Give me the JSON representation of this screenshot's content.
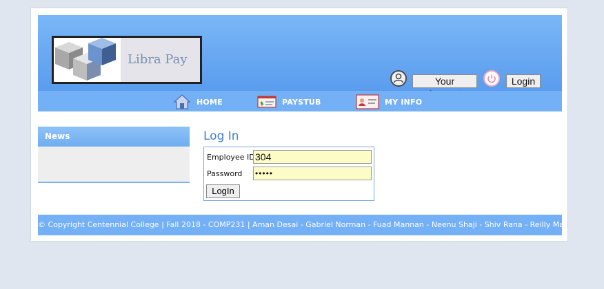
{
  "header": {
    "logo_text": "Libra Pay",
    "account_button": "Your Account",
    "login_button": "Login"
  },
  "nav": {
    "items": [
      {
        "label": "HOME",
        "icon": "home-icon"
      },
      {
        "label": "PAYSTUB",
        "icon": "paystub-icon"
      },
      {
        "label": "MY INFO",
        "icon": "id-card-icon"
      }
    ]
  },
  "news": {
    "title": "News"
  },
  "login": {
    "title": "Log In",
    "employee_id_label": "Employee ID",
    "employee_id_value": "304",
    "password_label": "Password",
    "password_value": "•••••",
    "submit_label": "LogIn"
  },
  "footer": {
    "text": "© Copyright Centennial College | Fall 2018 - COMP231 | Aman Desai - Gabriel Norman - Fuad Mannan - Neenu Shaji - Shiv Rana - Reilly Martinez"
  },
  "colors": {
    "header": "#6aaaf2",
    "accent": "#3d7fd6",
    "input_bg": "#fcfcc6"
  }
}
